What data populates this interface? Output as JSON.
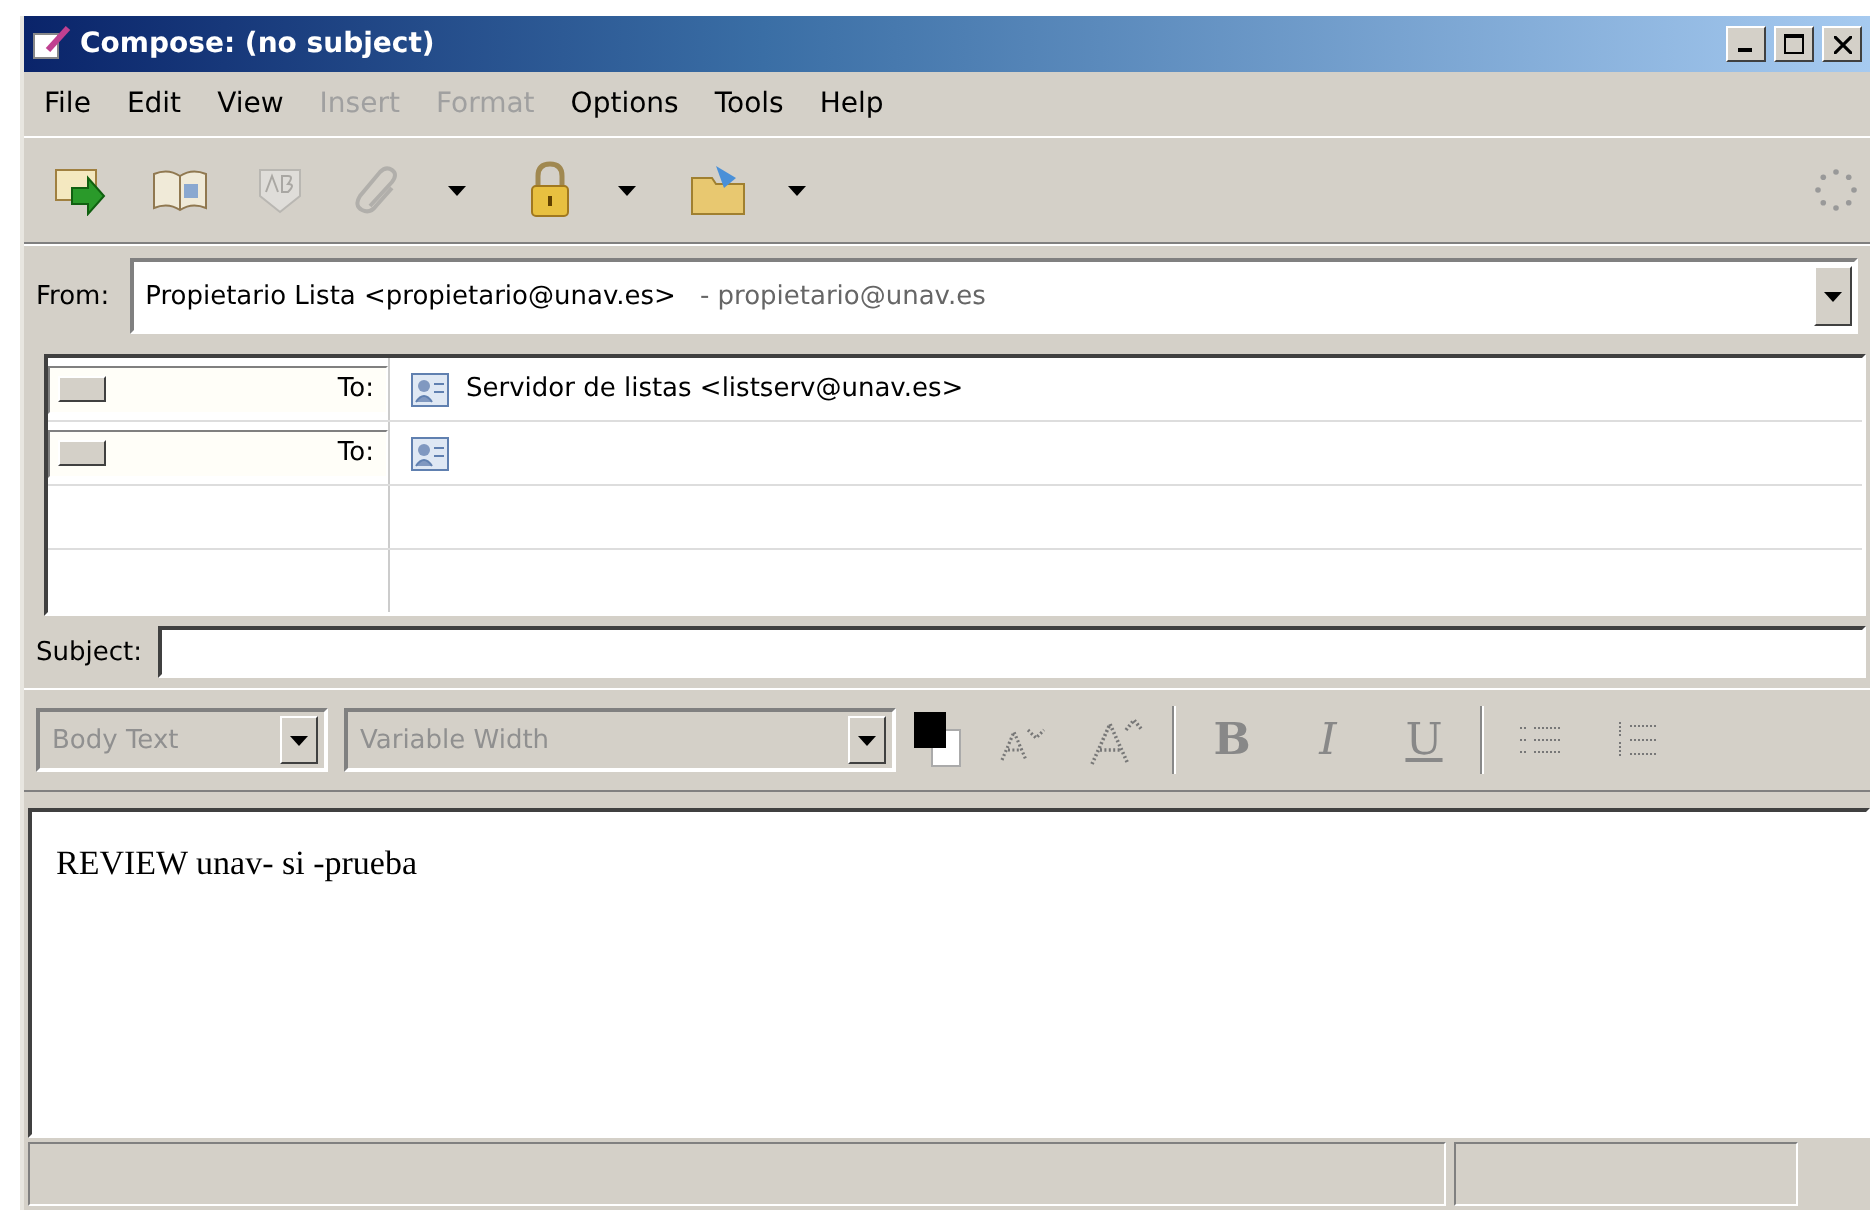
{
  "window": {
    "title": "Compose: (no subject)"
  },
  "menu": [
    {
      "label": "File",
      "disabled": false
    },
    {
      "label": "Edit",
      "disabled": false
    },
    {
      "label": "View",
      "disabled": false
    },
    {
      "label": "Insert",
      "disabled": true
    },
    {
      "label": "Format",
      "disabled": true
    },
    {
      "label": "Options",
      "disabled": false
    },
    {
      "label": "Tools",
      "disabled": false
    },
    {
      "label": "Help",
      "disabled": false
    }
  ],
  "toolbar": [
    {
      "kind": "send",
      "disabled": false,
      "dropdown": false
    },
    {
      "kind": "address",
      "disabled": false,
      "dropdown": false
    },
    {
      "kind": "spell",
      "disabled": true,
      "dropdown": false
    },
    {
      "kind": "attach",
      "disabled": true,
      "dropdown": true
    },
    {
      "kind": "lock",
      "disabled": false,
      "dropdown": true
    },
    {
      "kind": "save",
      "disabled": false,
      "dropdown": true
    }
  ],
  "from": {
    "label": "From:",
    "value": "Propietario Lista <propietario@unav.es>",
    "account": "- propietario@unav.es"
  },
  "recipients": [
    {
      "type": "To:",
      "address": "Servidor de listas <listserv@unav.es>"
    },
    {
      "type": "To:"
    }
  ],
  "subject": {
    "label": "Subject:"
  },
  "format_bar": {
    "paragraph": "Body Text",
    "font": "Variable Width",
    "disabled": true,
    "buttons": [
      {
        "kind": "smaller"
      },
      {
        "kind": "larger"
      },
      {
        "kind": "bold",
        "glyph": "B"
      },
      {
        "kind": "italic",
        "glyph": "I"
      },
      {
        "kind": "underline",
        "glyph": "U"
      },
      {
        "kind": "bullets"
      },
      {
        "kind": "numbers"
      }
    ]
  },
  "body": {
    "text": "REVIEW unav- si -prueba"
  }
}
